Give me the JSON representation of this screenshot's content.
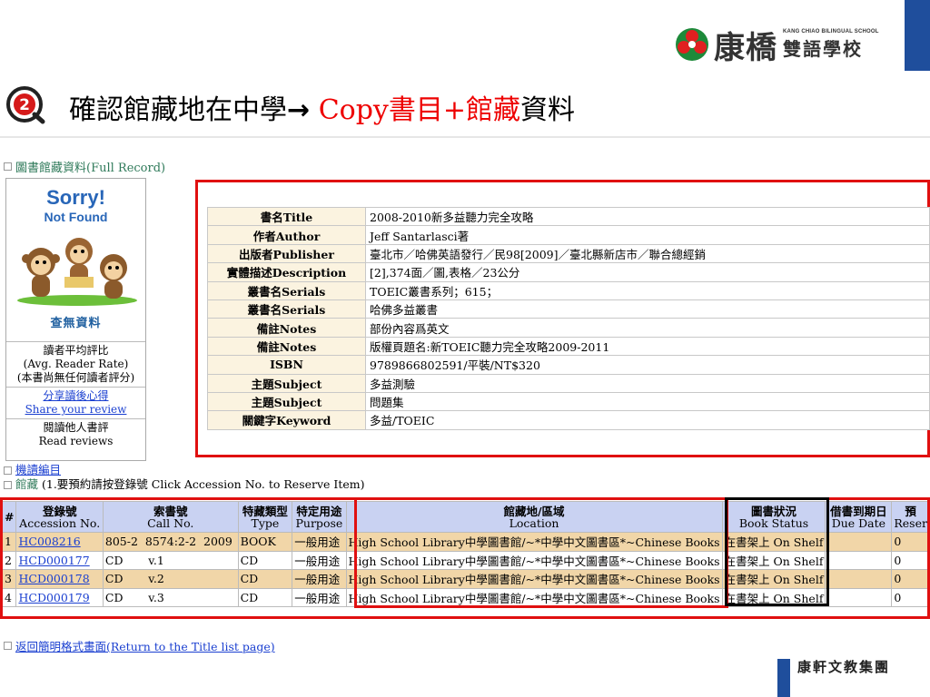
{
  "logo": {
    "cn": "康橋",
    "en": "KANG CHIAO BILINGUAL SCHOOL",
    "cn2": "雙語學校"
  },
  "slide": {
    "title_part1": "確認館藏地在中學",
    "arrow": "→",
    "title_red": "Copy書目+館藏",
    "title_part2": "資料"
  },
  "record": {
    "heading": "圖書館藏資料(Full Record)",
    "cover": {
      "sorry": "Sorry!",
      "not_found": "Not Found",
      "caption": "查無資料"
    },
    "panel": {
      "rate_cn": "讀者平均評比",
      "rate_en": "(Avg. Reader Rate)",
      "rate_note": "(本書尚無任何讀者評分)",
      "share_cn": "分享讀後心得",
      "share_en": "Share your review",
      "read_cn": "閱讀他人書評",
      "read_en": "Read reviews"
    },
    "fields": [
      {
        "label": "書名Title",
        "value": "2008-2010新多益聽力完全攻略"
      },
      {
        "label": "作者Author",
        "value": "Jeff Santarlasci著"
      },
      {
        "label": "出版者Publisher",
        "value": "臺北市／哈佛英語發行／民98[2009]／臺北縣新店市／聯合總經銷"
      },
      {
        "label": "實體描述Description",
        "value": "[2],374面／圖,表格／23公分"
      },
      {
        "label": "叢書名Serials",
        "value": "TOEIC叢書系列；615；"
      },
      {
        "label": "叢書名Serials",
        "value": "哈佛多益叢書"
      },
      {
        "label": "備註Notes",
        "value": "部份內容爲英文"
      },
      {
        "label": "備註Notes",
        "value": "版權頁題名:新TOEIC聽力完全攻略2009-2011"
      },
      {
        "label": "ISBN",
        "value": "9789866802591/平裝/NT$320"
      },
      {
        "label": "主題Subject",
        "value": "多益測驗"
      },
      {
        "label": "主題Subject",
        "value": "問題集"
      },
      {
        "label": "關鍵字Keyword",
        "value": "多益/TOEIC"
      }
    ]
  },
  "holdings": {
    "machine_link": "機讀編目",
    "label_cn": "館藏",
    "note": "(1.要預約請按登錄號 Click Accession No. to Reserve Item)",
    "columns": [
      {
        "cn": "#",
        "en": ""
      },
      {
        "cn": "登錄號",
        "en": "Accession No."
      },
      {
        "cn": "索書號",
        "en": "Call No."
      },
      {
        "cn": "特藏類型",
        "en": "Type"
      },
      {
        "cn": "特定用途",
        "en": "Purpose"
      },
      {
        "cn": "館藏地/區域",
        "en": "Location"
      },
      {
        "cn": "圖書狀況",
        "en": "Book Status"
      },
      {
        "cn": "借書到期日",
        "en": "Due Date"
      },
      {
        "cn": "預",
        "en": "Reser"
      }
    ],
    "rows": [
      {
        "num": "1",
        "acc": "HC008216",
        "call": "805-2  8574:2-2  2009",
        "type": "BOOK",
        "purpose": "一般用途",
        "location": "High School Library中學圖書館/~*中學中文圖書區*~Chinese Books",
        "status": "在書架上 On Shelf",
        "due": "",
        "res": "0"
      },
      {
        "num": "2",
        "acc": "HCD000177",
        "call": "CD       v.1",
        "type": "CD",
        "purpose": "一般用途",
        "location": "High School Library中學圖書館/~*中學中文圖書區*~Chinese Books",
        "status": "在書架上 On Shelf",
        "due": "",
        "res": "0"
      },
      {
        "num": "3",
        "acc": "HCD000178",
        "call": "CD       v.2",
        "type": "CD",
        "purpose": "一般用途",
        "location": "High School Library中學圖書館/~*中學中文圖書區*~Chinese Books",
        "status": "在書架上 On Shelf",
        "due": "",
        "res": "0"
      },
      {
        "num": "4",
        "acc": "HCD000179",
        "call": "CD       v.3",
        "type": "CD",
        "purpose": "一般用途",
        "location": "High School Library中學圖書館/~*中學中文圖書區*~Chinese Books",
        "status": "在書架上 On Shelf",
        "due": "",
        "res": "0"
      }
    ]
  },
  "back_link": "返回簡明格式畫面(Return to the Title list page)",
  "footer": "康軒文教集團",
  "colors": {
    "highlight": "#e01010",
    "brand_blue": "#1f4e9c",
    "row_alt": "#f1d6a8",
    "header_bg": "#c9d2f2"
  }
}
